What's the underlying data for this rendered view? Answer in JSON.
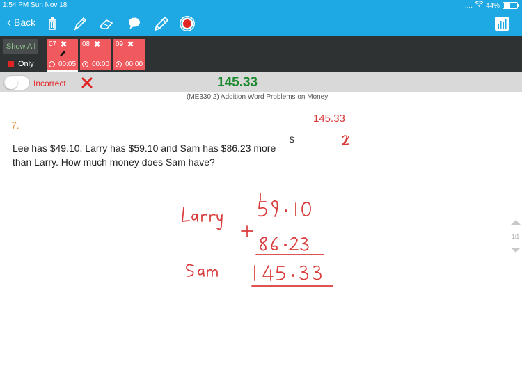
{
  "status_bar": {
    "time": "1:54 PM  Sun Nov 18",
    "dots": "....",
    "battery": "44%",
    "battery_level": 0.44
  },
  "toolbar": {
    "back_label": "Back",
    "tools": [
      "trash-icon",
      "pen-icon",
      "eraser-icon",
      "comment-icon",
      "pencil-icon",
      "record-icon"
    ],
    "right_tool": "stats-icon"
  },
  "timers": {
    "show_all": "Show All",
    "only": "Only",
    "tabs": [
      {
        "num": "07",
        "time": "00:05",
        "active": true
      },
      {
        "num": "08",
        "time": "00:00",
        "active": false
      },
      {
        "num": "09",
        "time": "00:00",
        "active": false
      }
    ]
  },
  "result": {
    "toggle_label": "Incorrect",
    "score": "145.33"
  },
  "subtitle": "(ME330.2) Addition Word Problems on Money",
  "question": {
    "number": "7.",
    "text": "Lee has $49.10, Larry has $59.10 and Sam has $86.23 more than Larry. How much money does Sam have?",
    "currency": "$",
    "answer": "145.33"
  },
  "pager": {
    "label": "1/1"
  },
  "colors": {
    "toolbar": "#1ea8e4",
    "dark": "#2f3233",
    "tab": "#f0595d",
    "correct": "#1b8a2e",
    "incorrect": "#e02525",
    "ink": "#d93a3a"
  }
}
